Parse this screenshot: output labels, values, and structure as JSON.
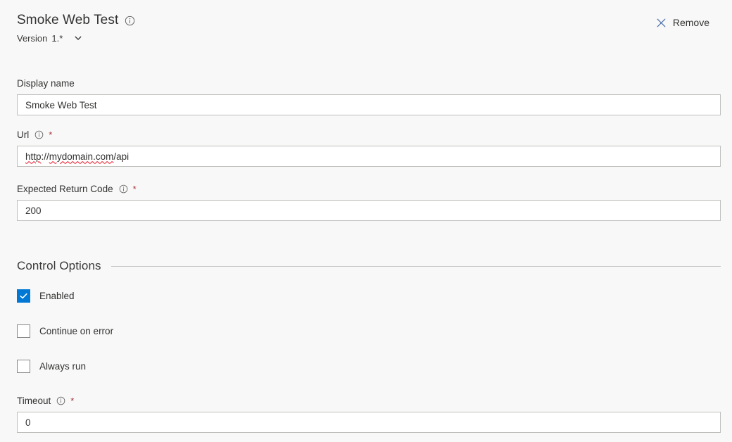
{
  "header": {
    "title": "Smoke Web Test",
    "title_info_icon": "info-icon",
    "version_label": "Version",
    "version_value": "1.*",
    "version_chevron_icon": "chevron-down-icon",
    "remove_label": "Remove",
    "remove_icon": "close-x-icon"
  },
  "fields": {
    "display_name": {
      "label": "Display name",
      "value": "Smoke Web Test",
      "required": false,
      "has_info": false
    },
    "url": {
      "label": "Url",
      "required": true,
      "required_marker": "*",
      "has_info": true,
      "info_icon": "info-icon",
      "value": "http://mydomain.com/api",
      "value_parts": [
        {
          "text": "http",
          "misspelled": true
        },
        {
          "text": "://",
          "misspelled": false
        },
        {
          "text": "mydomain.com",
          "misspelled": true
        },
        {
          "text": "/api",
          "misspelled": false
        }
      ]
    },
    "expected_return_code": {
      "label": "Expected Return Code",
      "required": true,
      "required_marker": "*",
      "has_info": true,
      "info_icon": "info-icon",
      "value": "200"
    },
    "timeout": {
      "label": "Timeout",
      "required": true,
      "required_marker": "*",
      "has_info": true,
      "info_icon": "info-icon",
      "value": "0"
    }
  },
  "control_options": {
    "section_title": "Control Options",
    "checkboxes": [
      {
        "label": "Enabled",
        "checked": true
      },
      {
        "label": "Continue on error",
        "checked": false
      },
      {
        "label": "Always run",
        "checked": false
      }
    ]
  },
  "colors": {
    "accent": "#0078d4",
    "required_star": "#a4373a",
    "spellcheck_underline": "#e81123",
    "page_background": "#f8f8f8",
    "input_background": "#ffffff",
    "input_border": "#bfbfbc",
    "divider": "#c8c6c4",
    "remove_icon": "#4a6fa8"
  }
}
